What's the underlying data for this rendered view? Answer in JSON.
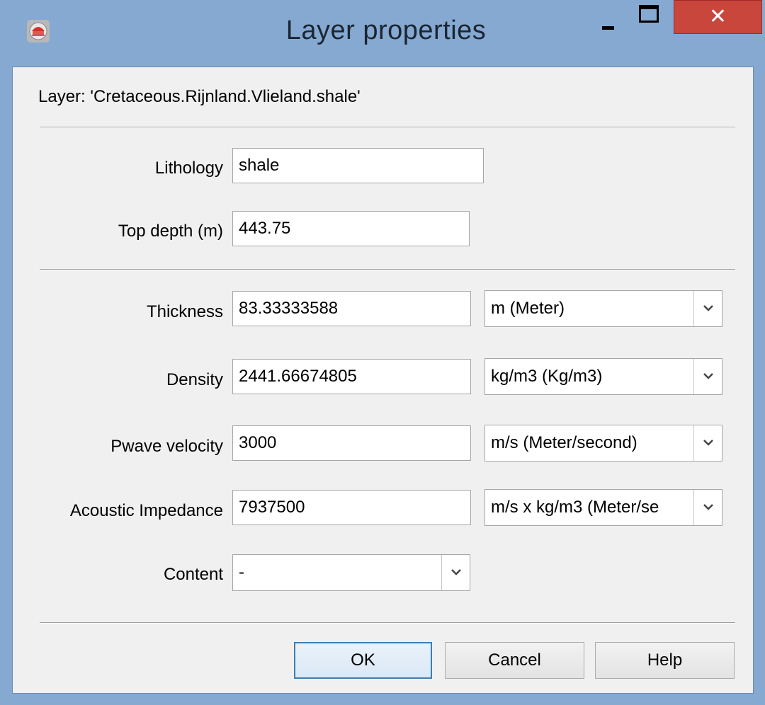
{
  "window": {
    "title": "Layer properties",
    "close_glyph": "✕",
    "app_icon": "app-icon"
  },
  "layer": {
    "label": "Layer: 'Cretaceous.Rijnland.Vlieland.shale'"
  },
  "fields": {
    "lithology": {
      "label": "Lithology",
      "value": "shale"
    },
    "top_depth": {
      "label": "Top depth (m)",
      "value": "443.75"
    },
    "thickness": {
      "label": "Thickness",
      "value": "83.33333588",
      "unit": "m (Meter)"
    },
    "density": {
      "label": "Density",
      "value": "2441.66674805",
      "unit": "kg/m3 (Kg/m3)"
    },
    "pwave": {
      "label": "Pwave velocity",
      "value": "3000",
      "unit": "m/s (Meter/second)"
    },
    "impedance": {
      "label": "Acoustic Impedance",
      "value": "7937500",
      "unit": "m/s x kg/m3 (Meter/se"
    },
    "content": {
      "label": "Content",
      "value": "-"
    }
  },
  "buttons": {
    "ok": "OK",
    "cancel": "Cancel",
    "help": "Help"
  },
  "colors": {
    "frame": "#86a9d2",
    "close": "#c9463d",
    "client": "#f0f0f0",
    "default_button_border": "#3c7fb1"
  }
}
